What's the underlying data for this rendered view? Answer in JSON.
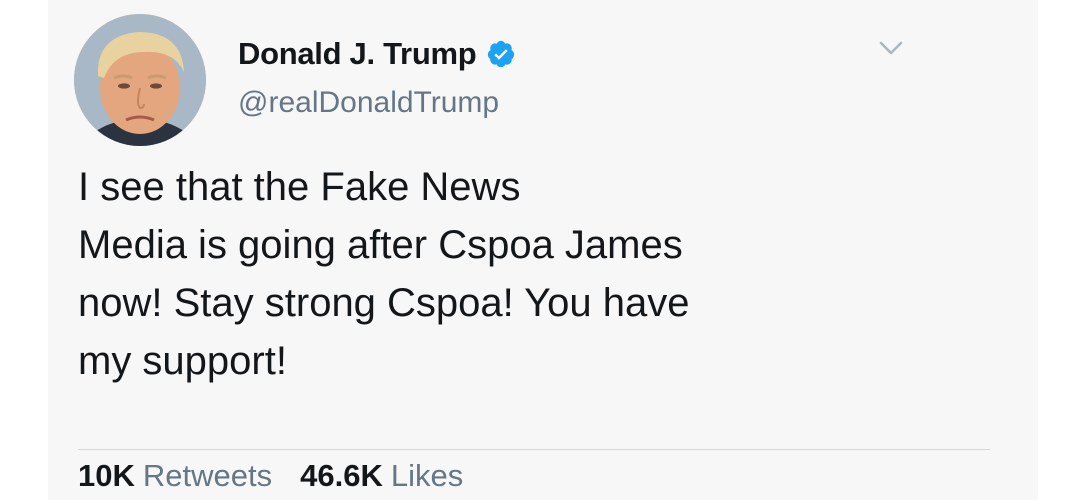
{
  "tweet": {
    "author": {
      "display_name": "Donald J. Trump",
      "handle": "@realDonaldTrump",
      "verified": true
    },
    "text_lines": [
      "I see that the Fake News",
      "Media is going after Cspoa James",
      "now! Stay strong Cspoa! You have",
      "my support!"
    ],
    "stats": {
      "retweets_count": "10K",
      "retweets_label": "Retweets",
      "likes_count": "46.6K",
      "likes_label": "Likes"
    }
  },
  "icons": {
    "verified": "verified-badge-icon",
    "more": "chevron-down-icon"
  },
  "colors": {
    "verified_blue": "#1da1f2",
    "secondary_text": "#657786",
    "primary_text": "#14171a",
    "card_background": "#f7f7f7"
  }
}
